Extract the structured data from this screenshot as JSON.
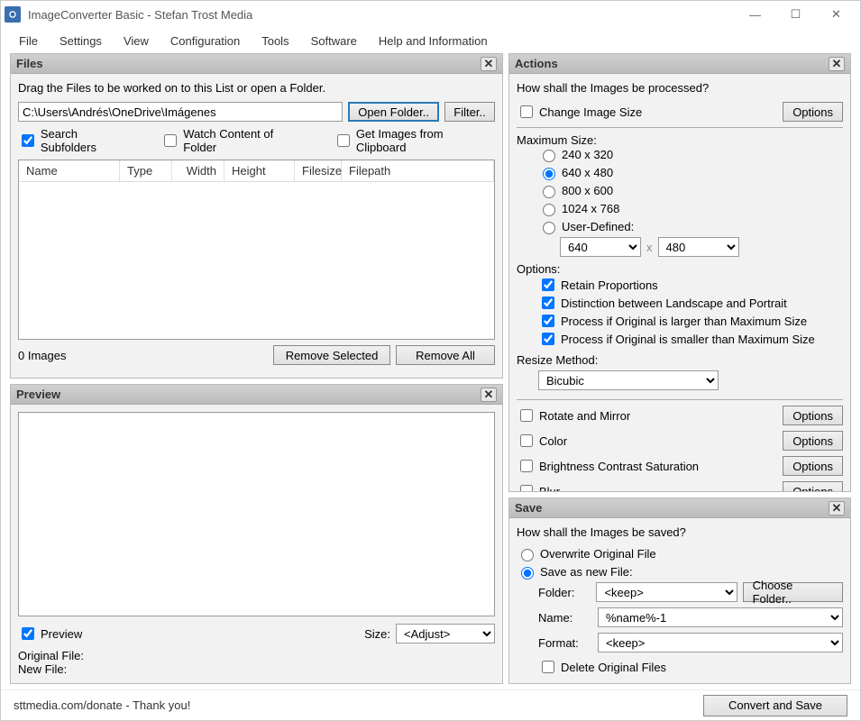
{
  "title": "ImageConverter Basic - Stefan Trost Media",
  "menu": [
    "File",
    "Settings",
    "View",
    "Configuration",
    "Tools",
    "Software",
    "Help and Information"
  ],
  "files": {
    "header": "Files",
    "hint": "Drag the Files to be worked on to this List or open a Folder.",
    "path": "C:\\Users\\Andrés\\OneDrive\\Imágenes",
    "open_folder": "Open Folder..",
    "filter": "Filter..",
    "search_subfolders": "Search Subfolders",
    "watch_folder": "Watch Content of Folder",
    "get_clipboard": "Get Images from Clipboard",
    "columns": [
      "Name",
      "Type",
      "Width",
      "Height",
      "Filesize",
      "Filepath"
    ],
    "widths": [
      112,
      58,
      58,
      78,
      52,
      130
    ],
    "count": "0 Images",
    "remove_selected": "Remove Selected",
    "remove_all": "Remove All"
  },
  "preview": {
    "header": "Preview",
    "preview_chk": "Preview",
    "size_label": "Size:",
    "size_value": "<Adjust>",
    "orig": "Original File:",
    "newf": "New File:"
  },
  "actions": {
    "header": "Actions",
    "prompt": "How shall the Images be processed?",
    "options_btn": "Options",
    "change_size": "Change Image Size",
    "max_size": "Maximum Size:",
    "sizes": [
      "240 x 320",
      "640 x 480",
      "800 x 600",
      "1024 x 768",
      "User-Defined:"
    ],
    "selected_size": "640 x 480",
    "ud_w": "640",
    "ud_h": "480",
    "x": "x",
    "options_label": "Options:",
    "opt1": "Retain Proportions",
    "opt2": "Distinction between Landscape and Portrait",
    "opt3": "Process if Original is larger than Maximum Size",
    "opt4": "Process if Original is smaller than Maximum Size",
    "resize_method": "Resize Method:",
    "method": "Bicubic",
    "rotate": "Rotate and Mirror",
    "color": "Color",
    "bcs": "Brightness Contrast Saturation",
    "blur": "Blur"
  },
  "save": {
    "header": "Save",
    "prompt": "How shall the Images be saved?",
    "overwrite": "Overwrite Original File",
    "saveas": "Save as new File:",
    "folder_label": "Folder:",
    "folder_value": "<keep>",
    "choose_folder": "Choose Folder..",
    "name_label": "Name:",
    "name_value": "%name%-1",
    "format_label": "Format:",
    "format_value": "<keep>",
    "delete_orig": "Delete Original Files"
  },
  "footer": {
    "donate": "sttmedia.com/donate - Thank you!",
    "convert": "Convert and Save"
  }
}
